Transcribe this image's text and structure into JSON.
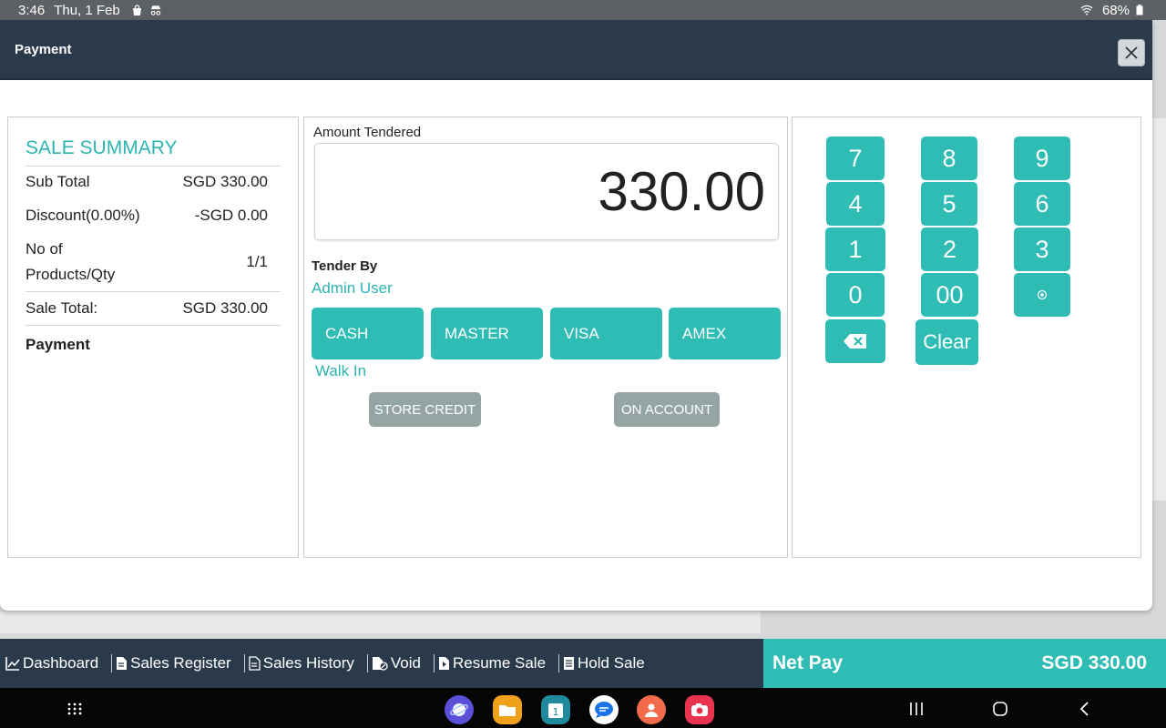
{
  "status_bar": {
    "time": "3:46",
    "date": "Thu, 1 Feb",
    "battery": "68%"
  },
  "modal": {
    "title": "Payment",
    "close_icon": "close-icon"
  },
  "sale_summary": {
    "title": "SALE SUMMARY",
    "sub_total_label": "Sub Total",
    "sub_total_value": "SGD 330.00",
    "discount_label": "Discount(0.00%)",
    "discount_value": "-SGD 0.00",
    "products_label_line1": "No of",
    "products_label_line2": "Products/Qty",
    "products_value": "1/1",
    "sale_total_label": "Sale Total:",
    "sale_total_value": "SGD 330.00",
    "payment_label": "Payment"
  },
  "tender": {
    "amount_label": "Amount Tendered",
    "amount_value": "330.00",
    "tender_by_label": "Tender By",
    "tender_by_user": "Admin User",
    "methods": [
      "CASH",
      "MASTER",
      "VISA",
      "AMEX"
    ],
    "customer": "Walk In",
    "store_credit": "STORE CREDIT",
    "on_account": "ON ACCOUNT"
  },
  "keypad": {
    "keys": [
      "7",
      "8",
      "9",
      "4",
      "5",
      "6",
      "1",
      "2",
      "3",
      "0",
      "00"
    ],
    "clear": "Clear",
    "decimal_icon": "dot-icon",
    "backspace_icon": "backspace-icon"
  },
  "bottom_nav": {
    "dashboard": "Dashboard",
    "sales_register": "Sales Register",
    "sales_history": "Sales History",
    "void": "Void",
    "resume_sale": "Resume Sale",
    "hold_sale": "Hold Sale"
  },
  "net_pay": {
    "label": "Net Pay",
    "value": "SGD 330.00"
  },
  "colors": {
    "accent": "#2ebcb4",
    "header": "#2b3a4b",
    "muted_button": "#95a5a4"
  }
}
